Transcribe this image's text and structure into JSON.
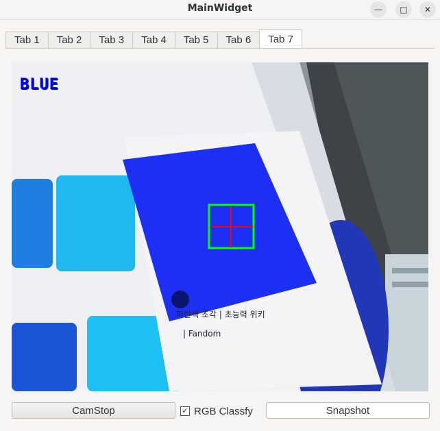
{
  "window": {
    "title": "MainWidget"
  },
  "tabs": [
    {
      "label": "Tab 1",
      "active": false
    },
    {
      "label": "Tab 2",
      "active": false
    },
    {
      "label": "Tab 3",
      "active": false
    },
    {
      "label": "Tab 4",
      "active": false
    },
    {
      "label": "Tab 5",
      "active": false
    },
    {
      "label": "Tab 6",
      "active": false
    },
    {
      "label": "Tab 7",
      "active": true
    }
  ],
  "camera": {
    "detected_color_label": "BLUE",
    "label_color": "#0000ff",
    "target_box_color": "#00ff00",
    "crosshair_color": "#ff0000"
  },
  "controls": {
    "camstop_label": "CamStop",
    "rgb_classify_label": "RGB Classfy",
    "rgb_classify_checked": true,
    "checkbox_glyph": "✓",
    "snapshot_label": "Snapshot"
  }
}
